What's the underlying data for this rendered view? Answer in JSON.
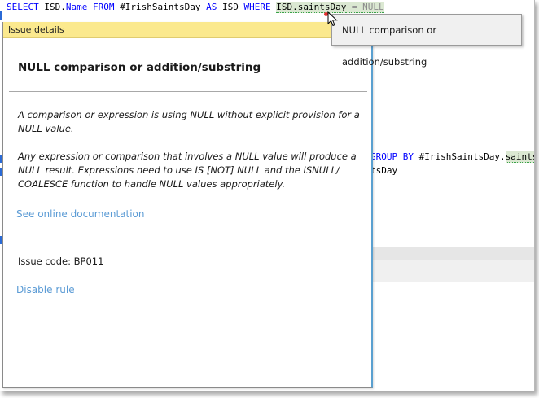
{
  "editor": {
    "line1": {
      "select": "SELECT",
      "col_prefix": " ISD.",
      "col_name": "Name",
      "from": " FROM",
      "table": " #IrishSaintsDay ",
      "as": "AS",
      "alias": " ISD ",
      "where": "WHERE",
      "space": " ",
      "condition": "ISD.saintsDay",
      "null_part": " = NULL"
    },
    "groupby_line": {
      "keyword": "GROUP BY",
      "text": " #IrishSaintsDay.",
      "ident": "saints"
    },
    "line3": {
      "text": "tsDay"
    }
  },
  "issue_panel": {
    "header": "Issue details",
    "title": "NULL comparison or addition/substring",
    "paragraph1": "A comparison or expression is using NULL without explicit provision for a NULL value.",
    "paragraph2": "Any expression or comparison that involves a NULL value will produce a NULL result. Expressions need to use IS [NOT] NULL and the ISNULL/ COALESCE function to handle NULL values appropriately.",
    "doc_link": "See online documentation",
    "issue_code": "Issue code: BP011",
    "disable_link": "Disable rule"
  },
  "tooltip": {
    "text": "NULL comparison or addition/substring"
  },
  "colors": {
    "keyword": "#0000ff",
    "header_bg": "#fbe98e",
    "link": "#5b9bd5",
    "highlight": "#dbe8d2",
    "error_dot": "#e03030"
  }
}
